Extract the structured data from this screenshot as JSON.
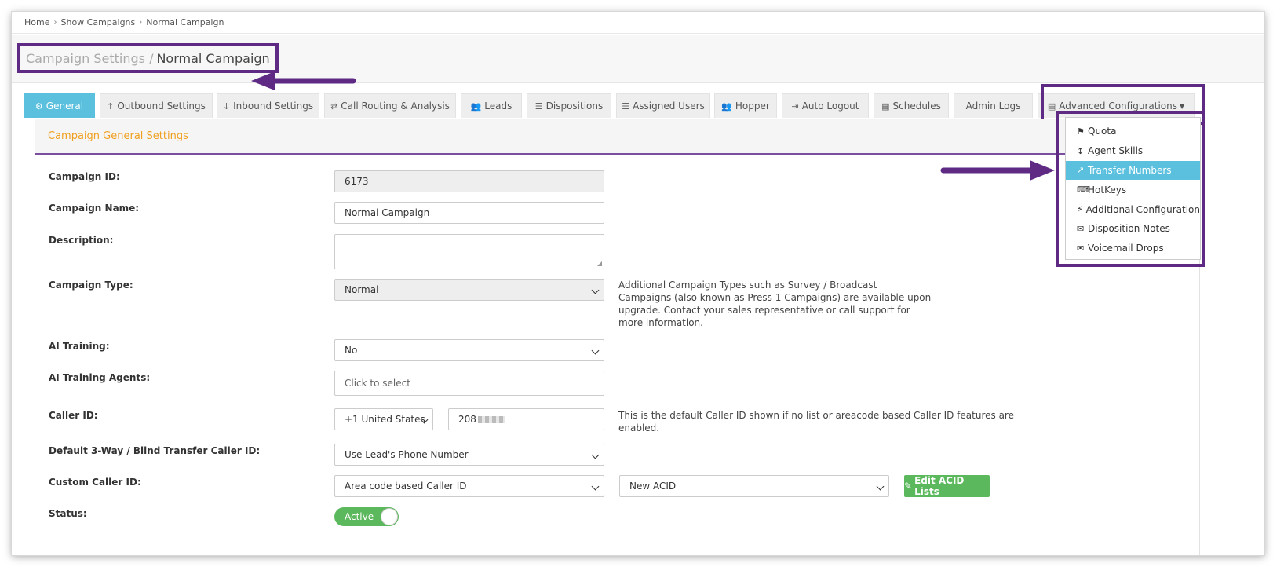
{
  "breadcrumb": [
    "Home",
    "Show Campaigns",
    "Normal Campaign"
  ],
  "header": {
    "title_prefix": "Campaign Settings /",
    "title_main": "Normal Campaign"
  },
  "tabs": [
    {
      "label": "General",
      "icon": "cogs-icon",
      "active": true
    },
    {
      "label": "Outbound Settings",
      "icon": "arrow-up-icon"
    },
    {
      "label": "Inbound Settings",
      "icon": "arrow-down-icon"
    },
    {
      "label": "Call Routing & Analysis",
      "icon": "random-icon"
    },
    {
      "label": "Leads",
      "icon": "users-icon"
    },
    {
      "label": "Dispositions",
      "icon": "list-icon"
    },
    {
      "label": "Assigned Users",
      "icon": "list-ol-icon"
    },
    {
      "label": "Hopper",
      "icon": "users-icon"
    },
    {
      "label": "Auto Logout",
      "icon": "sign-out-icon"
    },
    {
      "label": "Schedules",
      "icon": "calendar-icon"
    },
    {
      "label": "Admin Logs",
      "icon": ""
    },
    {
      "label": "Advanced Configurations",
      "icon": "list-alt-icon"
    }
  ],
  "dropdown": [
    {
      "label": "Quota",
      "icon": "flag-icon"
    },
    {
      "label": "Agent Skills",
      "icon": "arrows-v-icon"
    },
    {
      "label": "Transfer Numbers",
      "icon": "share-square-icon",
      "selected": true
    },
    {
      "label": "HotKeys",
      "icon": "keyboard-icon"
    },
    {
      "label": "Additional Configuration",
      "icon": "plug-icon"
    },
    {
      "label": "Disposition Notes",
      "icon": "envelope-icon"
    },
    {
      "label": "Voicemail Drops",
      "icon": "envelope-icon"
    }
  ],
  "panel": {
    "heading": "Campaign General Settings"
  },
  "form": {
    "campaign_id": {
      "label": "Campaign ID:",
      "value": "6173"
    },
    "campaign_name": {
      "label": "Campaign Name:",
      "value": "Normal Campaign"
    },
    "description": {
      "label": "Description:",
      "value": ""
    },
    "campaign_type": {
      "label": "Campaign Type:",
      "value": "Normal",
      "help": [
        "Additional Campaign Types such as Survey / Broadcast",
        "Campaigns (also known as Press 1 Campaigns) are available upon",
        "upgrade. Contact your sales representative or call support for",
        "more information."
      ]
    },
    "ai_training": {
      "label": "AI Training:",
      "value": "No"
    },
    "ai_training_agents": {
      "label": "AI Training Agents:",
      "placeholder": "Click to select"
    },
    "caller_id": {
      "label": "Caller ID:",
      "country": "+1 United States",
      "number": "208",
      "help": [
        "This is the default Caller ID shown if no list or areacode based Caller ID features are",
        "enabled."
      ]
    },
    "transfer_caller_id": {
      "label": "Default 3-Way / Blind Transfer Caller ID:",
      "value": "Use Lead's Phone Number"
    },
    "custom_caller_id": {
      "label": "Custom Caller ID:",
      "value": "Area code based Caller ID",
      "list": "New ACID",
      "button": "Edit ACID Lists"
    },
    "status": {
      "label": "Status:",
      "value": "Active"
    }
  },
  "colors": {
    "accent": "#5bc0de",
    "highlight_frame": "#5e2a84",
    "orange": "#f0a020",
    "green": "#5cb85c"
  }
}
